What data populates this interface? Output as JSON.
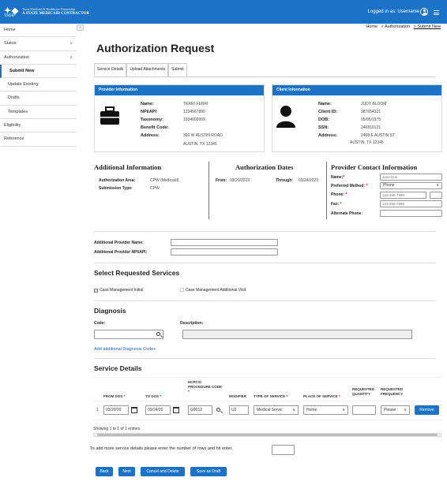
{
  "header": {
    "logo": "TMHP",
    "logo_line1": "Texas Medicaid & Healthcare Partnership",
    "logo_line2": "A STATE MEDICAID CONTRACTOR",
    "logged_in": "Logged in as: Username"
  },
  "sidebar": {
    "items": [
      {
        "label": "Home"
      },
      {
        "label": "Status"
      },
      {
        "label": "Authorization"
      },
      {
        "label": "Submit New"
      },
      {
        "label": "Update Existing"
      },
      {
        "label": "Drafts"
      },
      {
        "label": "Templates"
      },
      {
        "label": "Eligibility"
      },
      {
        "label": "Reference"
      }
    ]
  },
  "breadcrumb": [
    "Home",
    "> Authorization",
    "> Submit New"
  ],
  "page_title": "Authorization Request",
  "tabs": [
    "Service Details",
    "Upload Attachments",
    "Submit"
  ],
  "provider": {
    "header": "Provider Information",
    "rows": [
      {
        "k": "Name:",
        "v": "TERRI FERRI"
      },
      {
        "k": "NPI/API:",
        "v": "1234567890"
      },
      {
        "k": "Taxonomy:",
        "v": "193400000X"
      },
      {
        "k": "Benefit Code:",
        "v": ""
      },
      {
        "k": "Address:",
        "v": "369 W AUSTIN ROAD"
      }
    ],
    "address2": "AUSTIN, TX 12345"
  },
  "client": {
    "header": "Client Information",
    "rows": [
      {
        "k": "Name:",
        "v": "JUDY BLOOM"
      },
      {
        "k": "Client ID:",
        "v": "987654321"
      },
      {
        "k": "DOB:",
        "v": "05/05/1975"
      },
      {
        "k": "SSN:",
        "v": "246810121"
      },
      {
        "k": "Address:",
        "v": "2468 E AUSTIN ST"
      }
    ],
    "address2": "AUSTIN, TX 12345"
  },
  "additional": {
    "title": "Additional Information",
    "area_label": "Authorization Area:",
    "area_value": "CPW (Medicaid)",
    "type_label": "Submission Type:",
    "type_value": "CPW"
  },
  "dates": {
    "title": "Authorization Dates",
    "from_label": "From:",
    "from_value": "03/20/2023",
    "through_label": "Through:",
    "through_value": "03/24/2023"
  },
  "contact": {
    "title": "Provider Contact Information",
    "name_label": "Name:",
    "name_placeholder": "Jane Doe",
    "method_label": "Preferred Method:",
    "method_value": "Phone",
    "phone_label": "Phone:",
    "phone_placeholder": "123-456-7890",
    "fax_label": "Fax:",
    "fax_placeholder": "123-456-7890",
    "alt_phone_label": "Alternate Phone:"
  },
  "additional_provider": {
    "name_label": "Additional Provider Name:",
    "npi_label": "Additional Provider NPI/API:"
  },
  "services": {
    "title": "Select Requested Services",
    "initial": "Case Management Initial",
    "additional": "Case Management Additional Visit"
  },
  "diagnosis": {
    "title": "Diagnosis",
    "code_label": "Code:",
    "desc_label": "Description:",
    "add_link": "Add additional Diagnosis Code+"
  },
  "service_details": {
    "title": "Service Details",
    "columns": {
      "from_dos": "FROM DOS",
      "to_dos": "TO DOS",
      "hcpcs_1": "HCPCS/",
      "hcpcs_2": "PROCEDURE CODE",
      "modifier": "MODIFIER",
      "type": "TYPE OF SERVICE",
      "place": "PLACE OF SERVICE",
      "qty_1": "REQUESTED",
      "qty_2": "QUANTITY",
      "freq_1": "REQUESTED",
      "freq_2": "FREQUENCY"
    },
    "row": {
      "num": "1",
      "from": "03/20/20",
      "to": "03/24/20",
      "code": "G9012",
      "modifier": "U2",
      "type": "Medical Servic",
      "place": "Home",
      "frequency": "Please :",
      "remove": "Remove"
    },
    "showing": "Showing 1 to 1 of 1 entries",
    "add_rows": "To add more service details please enter the number of rows and hit enter."
  },
  "buttons": {
    "back": "Back",
    "next": "Next",
    "cancel": "Cancel and Delete",
    "draft": "Save as Draft"
  }
}
